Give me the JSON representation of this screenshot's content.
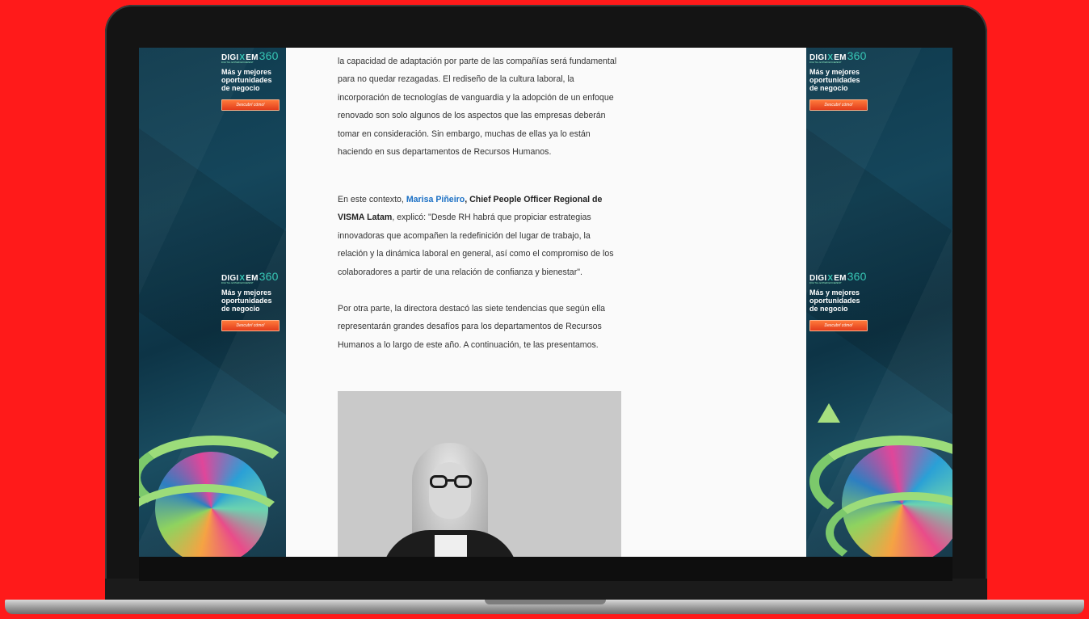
{
  "ad": {
    "logo_main": "DIGI",
    "logo_x": "X",
    "logo_em": "EM",
    "logo_num": "360",
    "logo_sub": "DIGITAL EXPERIENCEMENT",
    "headline_1": "Más y mejores",
    "headline_2": "oportunidades",
    "headline_3": "de negocio",
    "button": "Descubrí cómo!"
  },
  "article": {
    "p1": "la capacidad de adaptación por parte de las compañías será fundamental para no quedar rezagadas. El rediseño de la cultura laboral, la incorporación de tecnologías de vanguardia y la adopción de un enfoque renovado son solo algunos de los aspectos que las empresas deberán tomar en consideración. Sin embargo, muchas de ellas ya lo están haciendo en sus departamentos de Recursos Humanos.",
    "p2_pre": "En este contexto, ",
    "p2_link": "Marisa Piñeiro",
    "p2_bold": ", Chief People Officer Regional de VISMA Latam",
    "p2_post": ", explicó: \"Desde RH habrá que propiciar estrategias innovadoras que acompañen la redefinición del lugar de trabajo, la relación y la dinámica laboral en general, así como el compromiso de los colaboradores a partir de una relación de confianza y bienestar\".",
    "p3": "Por otra parte, la directora destacó las siete tendencias que según ella representarán grandes desafíos para los departamentos de Recursos Humanos a lo largo de este año. A continuación, te las presentamos."
  },
  "colors": {
    "background": "#ff1a1a",
    "ad_bg": "#0f3a4d",
    "accent_teal": "#37c6b5",
    "link": "#1a6fc4",
    "button": "#e23c1c"
  }
}
